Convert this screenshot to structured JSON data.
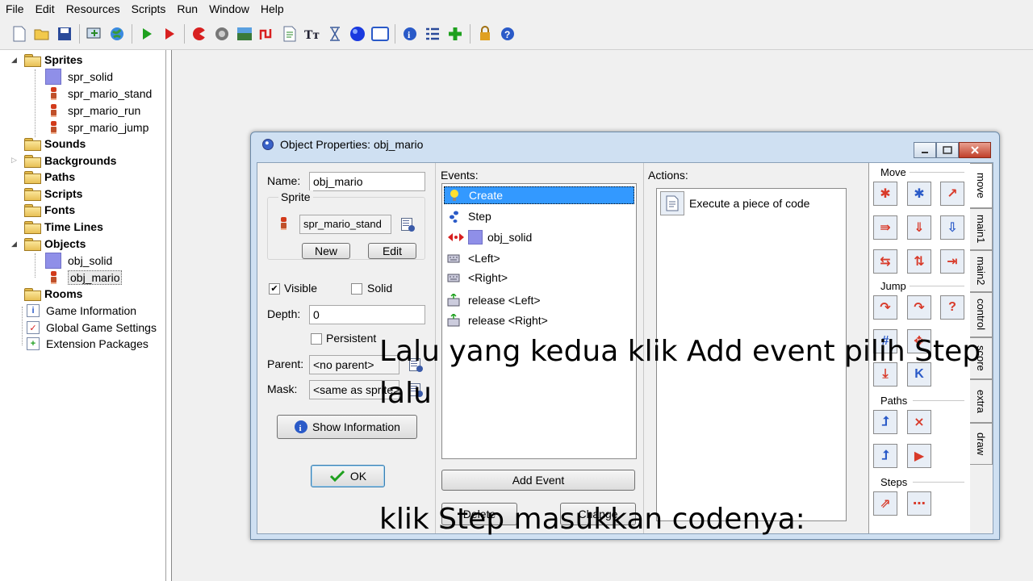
{
  "menu": [
    "File",
    "Edit",
    "Resources",
    "Scripts",
    "Run",
    "Window",
    "Help"
  ],
  "toolbar_icons": [
    "new-file",
    "open-folder",
    "save",
    "create-executable",
    "publish-web",
    "run",
    "run-debug",
    "add-sprite",
    "add-sound",
    "add-background",
    "add-path",
    "add-script",
    "add-font",
    "add-timeline",
    "add-object",
    "add-room",
    "game-information",
    "global-settings",
    "extension-packages",
    "manual",
    "help"
  ],
  "tree": {
    "groups": {
      "sprites": "Sprites",
      "sounds": "Sounds",
      "backgrounds": "Backgrounds",
      "paths": "Paths",
      "scripts": "Scripts",
      "fonts": "Fonts",
      "timelines": "Time Lines",
      "objects": "Objects",
      "rooms": "Rooms"
    },
    "sprites": [
      "spr_solid",
      "spr_mario_stand",
      "spr_mario_run",
      "spr_mario_jump"
    ],
    "objects": [
      "obj_solid",
      "obj_mario"
    ],
    "misc": [
      "Game Information",
      "Global Game Settings",
      "Extension Packages"
    ]
  },
  "dialog": {
    "title": "Object Properties: obj_mario",
    "name_label": "Name:",
    "name_value": "obj_mario",
    "sprite_group": "Sprite",
    "sprite_value": "spr_mario_stand",
    "new_btn": "New",
    "edit_btn": "Edit",
    "visible_label": "Visible",
    "visible_checked": true,
    "solid_label": "Solid",
    "solid_checked": false,
    "depth_label": "Depth:",
    "depth_value": "0",
    "persistent_label": "Persistent",
    "persistent_checked": false,
    "parent_label": "Parent:",
    "parent_value": "<no parent>",
    "mask_label": "Mask:",
    "mask_value": "<same as sprite>",
    "show_info_btn": "Show Information",
    "ok_btn": "OK",
    "events_label": "Events:",
    "events": [
      "Create",
      "Step",
      "obj_solid",
      "<Left>",
      "<Right>",
      "release <Left>",
      "release <Right>"
    ],
    "selected_event": "Create",
    "add_event_btn": "Add Event",
    "delete_btn": "Delete",
    "change_btn": "Change",
    "actions_label": "Actions:",
    "actions": [
      "Execute a piece of code"
    ],
    "palette_tabs": [
      "move",
      "main1",
      "main2",
      "control",
      "score",
      "extra",
      "draw"
    ],
    "active_tab": "move",
    "palette_sections": {
      "move": "Move",
      "jump": "Jump",
      "paths": "Paths",
      "steps": "Steps"
    }
  },
  "overlay": {
    "line1": "Lalu yang kedua klik Add event pilih Step lalu",
    "line2": "klik Step masukkan codenya:"
  },
  "colors": {
    "selection": "#3399ff",
    "sprite_solid": "#8f8fe8",
    "dialog_frame": "#cfe0f2",
    "action_icon_red": "#d83a2a",
    "action_icon_blue": "#2a5ac8"
  }
}
